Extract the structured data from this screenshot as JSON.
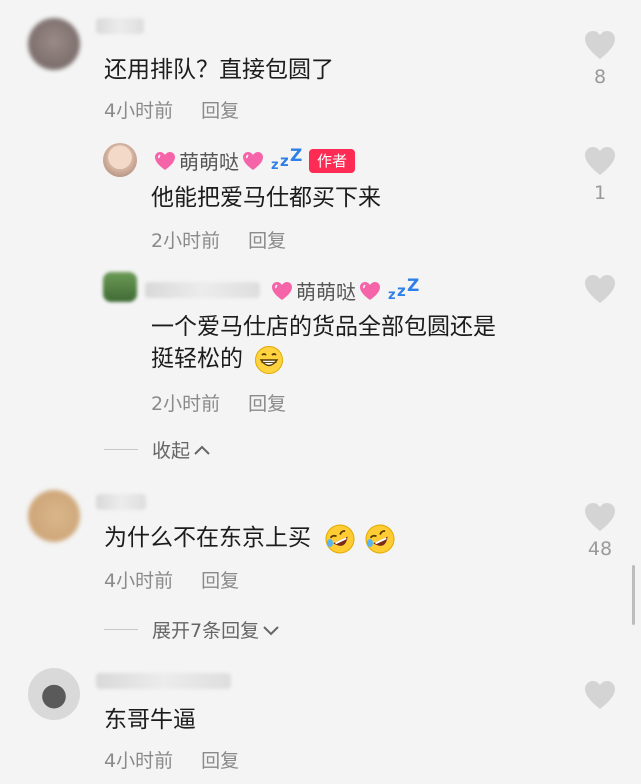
{
  "colors": {
    "like_icon": "#d4d4d4",
    "author_badge": "#fe2c55",
    "zzz": "#2f7fe8",
    "meta": "#8a8a8a"
  },
  "comments": [
    {
      "text": "还用排队？直接包圆了",
      "time": "4小时前",
      "reply_label": "回复",
      "likes": "8",
      "replies": [
        {
          "nickname": "萌萌哒",
          "badge": "作者",
          "text": "他能把爱马仕都买下来",
          "time": "2小时前",
          "reply_label": "回复",
          "likes": "1"
        },
        {
          "nickname": "萌萌哒",
          "text_line1": "一个爱马仕店的货品全部包圆还是",
          "text_line2": "挺轻松的",
          "time": "2小时前",
          "reply_label": "回复",
          "likes": ""
        }
      ],
      "collapse_label": "收起"
    },
    {
      "text": "为什么不在东京上买",
      "time": "4小时前",
      "reply_label": "回复",
      "likes": "48",
      "expand_label": "展开7条回复"
    },
    {
      "text": "东哥牛逼",
      "time": "4小时前",
      "reply_label": "回复",
      "likes": ""
    }
  ]
}
